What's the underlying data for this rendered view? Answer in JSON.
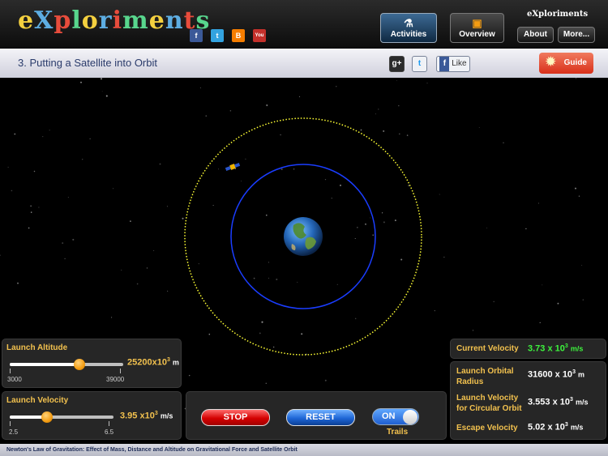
{
  "header": {
    "logo_text": "eXploriments",
    "mini_logo_text": "eXploriments",
    "social_icons": [
      "facebook-icon",
      "twitter-icon",
      "blogger-icon",
      "youtube-icon"
    ],
    "nav": {
      "activities_label": "Activities",
      "overview_label": "Overview",
      "about_label": "About",
      "more_label": "More..."
    }
  },
  "titlebar": {
    "title": "3. Putting a Satellite into Orbit",
    "share": {
      "gplus": "g+",
      "twitter": "t",
      "facebook_like": "Like"
    },
    "guide_label": "Guide"
  },
  "controls": {
    "altitude": {
      "title": "Launch Altitude",
      "value": "25200",
      "exponent_base": "x10",
      "exponent": "3",
      "unit": "m",
      "min_label": "3000",
      "max_label": "39000",
      "level": 0.617
    },
    "velocity": {
      "title": "Launch Velocity",
      "value": "3.95",
      "exponent_base": "x10",
      "exponent": "3",
      "unit": "m/s",
      "min_label": "2.5",
      "max_label": "6.5",
      "level": 0.362
    },
    "stop_label": "STOP",
    "reset_label": "RESET",
    "trails_toggle_label": "ON",
    "trails_label": "Trails"
  },
  "info": {
    "current_velocity_label": "Current Velocity",
    "current_velocity_value": "3.73 x 10",
    "current_velocity_exp": "3",
    "current_velocity_unit": "m/s",
    "orbital_radius_label_1": "Launch Orbital",
    "orbital_radius_label_2": "Radius",
    "orbital_radius_value": "31600 x 10",
    "orbital_radius_exp": "3",
    "orbital_radius_unit": "m",
    "circular_velocity_label_1": "Launch Velocity",
    "circular_velocity_label_2": "for Circular Orbit",
    "circular_velocity_value": "3.553 x 10",
    "circular_velocity_exp": "3",
    "circular_velocity_unit": "m/s",
    "escape_velocity_label": "Escape Velocity",
    "escape_velocity_value": "5.02 x 10",
    "escape_velocity_exp": "3",
    "escape_velocity_unit": "m/s"
  },
  "footer": {
    "text": "Newton's Law of Gravitation: Effect of Mass, Distance and Altitude on Gravitational Force and Satellite Orbit"
  },
  "colors": {
    "accent_label": "#f2c14e",
    "current_velocity": "#3df23d",
    "orbit_trail": "#ffff33",
    "circular_orbit": "#1a3dff",
    "stop": "#d40000",
    "reset": "#1e66d6"
  }
}
